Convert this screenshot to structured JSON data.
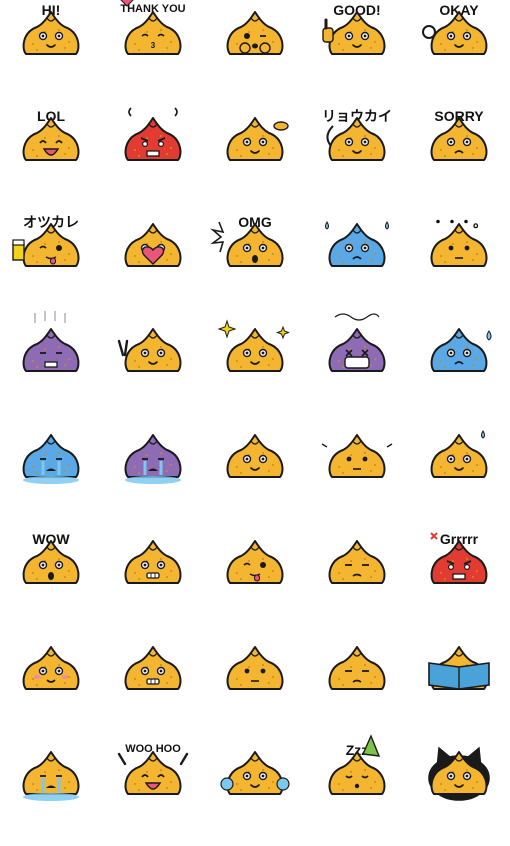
{
  "colors": {
    "bun_fill": "#f4b531",
    "bun_dark": "#c98a1c",
    "outline": "#1a1a1a",
    "red_fill": "#e23b32",
    "blue_fill": "#5aa9e6",
    "purple_fill": "#8e6bb5",
    "mask": "#ffffff",
    "heart": "#e8577a",
    "book": "#4aa3d8",
    "cat": "#1a1a1a",
    "tears": "#7cc8f0",
    "hat": "#7bc34a",
    "spark": "#f2d21b"
  },
  "stickers": [
    {
      "caption": "HI!",
      "fill": "bun",
      "face": "smile",
      "extra": ""
    },
    {
      "caption": "THANK YOU",
      "fill": "bun",
      "face": "kiss",
      "extra": "heart"
    },
    {
      "caption": "",
      "fill": "bun",
      "face": "wink",
      "extra": "hands"
    },
    {
      "caption": "GOOD!",
      "fill": "bun",
      "face": "smile",
      "extra": "thumb"
    },
    {
      "caption": "OKAY",
      "fill": "bun",
      "face": "smile",
      "extra": "ok"
    },
    {
      "caption": "LOL",
      "fill": "bun",
      "face": "laugh",
      "extra": ""
    },
    {
      "caption": "",
      "fill": "red",
      "face": "angry",
      "extra": "steam"
    },
    {
      "caption": "",
      "fill": "bun",
      "face": "smile",
      "extra": "salute"
    },
    {
      "caption": "リョウカイ",
      "fill": "bun",
      "face": "smile",
      "extra": "arm"
    },
    {
      "caption": "SORRY",
      "fill": "bun",
      "face": "sad",
      "extra": ""
    },
    {
      "caption": "オツカレ",
      "fill": "bun",
      "face": "tongue",
      "extra": "beer"
    },
    {
      "caption": "",
      "fill": "bun",
      "face": "smile",
      "extra": "heartbox"
    },
    {
      "caption": "OMG",
      "fill": "bun",
      "face": "shock",
      "extra": "burst"
    },
    {
      "caption": "",
      "fill": "blue",
      "face": "sad",
      "extra": "drops"
    },
    {
      "caption": "・・・。",
      "fill": "bun",
      "face": "flat",
      "extra": ""
    },
    {
      "caption": "",
      "fill": "purple",
      "face": "gloom",
      "extra": "lines"
    },
    {
      "caption": "",
      "fill": "bun",
      "face": "smile",
      "extra": "peace"
    },
    {
      "caption": "",
      "fill": "bun",
      "face": "smile",
      "extra": "sparkle"
    },
    {
      "caption": "",
      "fill": "purple",
      "face": "dizzy",
      "extra": "mask"
    },
    {
      "caption": "",
      "fill": "blue",
      "face": "sad",
      "extra": "sweat"
    },
    {
      "caption": "",
      "fill": "blue",
      "face": "cry",
      "extra": "puddle"
    },
    {
      "caption": "",
      "fill": "purple",
      "face": "cry",
      "extra": "puddle"
    },
    {
      "caption": "",
      "fill": "bun",
      "face": "smile",
      "extra": ""
    },
    {
      "caption": "",
      "fill": "bun",
      "face": "flat",
      "extra": "marks"
    },
    {
      "caption": "",
      "fill": "bun",
      "face": "smile",
      "extra": "sweatdrop"
    },
    {
      "caption": "WOW",
      "fill": "bun",
      "face": "shock",
      "extra": ""
    },
    {
      "caption": "",
      "fill": "bun",
      "face": "grin",
      "extra": ""
    },
    {
      "caption": "",
      "fill": "bun",
      "face": "tongue",
      "extra": ""
    },
    {
      "caption": "",
      "fill": "bun",
      "face": "annoyed",
      "extra": ""
    },
    {
      "caption": "Grrrrr",
      "fill": "red",
      "face": "angry",
      "extra": "vein"
    },
    {
      "caption": "",
      "fill": "bun",
      "face": "blush",
      "extra": ""
    },
    {
      "caption": "",
      "fill": "bun",
      "face": "grin",
      "extra": ""
    },
    {
      "caption": "",
      "fill": "bun",
      "face": "flat",
      "extra": ""
    },
    {
      "caption": "",
      "fill": "bun",
      "face": "annoyed",
      "extra": ""
    },
    {
      "caption": "",
      "fill": "bun",
      "face": "smile",
      "extra": "book"
    },
    {
      "caption": "",
      "fill": "bun",
      "face": "cry",
      "extra": "puddle"
    },
    {
      "caption": "WOO HOO",
      "fill": "bun",
      "face": "laugh",
      "extra": "cheer"
    },
    {
      "caption": "",
      "fill": "bun",
      "face": "smile",
      "extra": "pompom"
    },
    {
      "caption": "Zzz",
      "fill": "bun",
      "face": "sleep",
      "extra": "hat"
    },
    {
      "caption": "",
      "fill": "cat",
      "face": "smile",
      "extra": "ears"
    }
  ]
}
